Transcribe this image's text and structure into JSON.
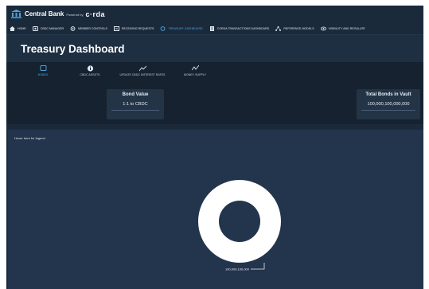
{
  "brand": {
    "name": "Central Bank",
    "powered_by": "Powered by",
    "corda": "c·rda"
  },
  "nav": {
    "items": [
      {
        "label": "HOME",
        "icon": "home-icon"
      },
      {
        "label": "CBDC MANAGER",
        "icon": "coins-icon"
      },
      {
        "label": "MEMBER CONTROLS",
        "icon": "gear-icon"
      },
      {
        "label": "RECEIVING REQUESTS",
        "icon": "inbox-icon"
      },
      {
        "label": "TREASURY DASHBOARD",
        "icon": "circle-icon",
        "active": true
      },
      {
        "label": "CORDA TRANSACTIONS DASHBOARD",
        "icon": "document-icon"
      },
      {
        "label": "REFERENCE MODELS",
        "icon": "network-icon"
      },
      {
        "label": "VISIBILITY AND REGULATE",
        "icon": "eye-icon"
      }
    ]
  },
  "page": {
    "title": "Treasury Dashboard"
  },
  "tabs": [
    {
      "label": "BONDS",
      "icon": "square-icon",
      "active": true
    },
    {
      "label": "CBDC ASSETS",
      "icon": "info-icon"
    },
    {
      "label": "UPDATE CBDC INTEREST RATES",
      "icon": "trend-icon"
    },
    {
      "label": "MONEY SUPPLY",
      "icon": "chart-line-icon"
    }
  ],
  "cards": {
    "bond_value": {
      "title": "Bond Value",
      "value": "1:1 to CBDC"
    },
    "total_bonds": {
      "title": "Total Bonds in Vault",
      "value": "100,000,100,000,000"
    }
  },
  "chart": {
    "hint": "Hover here for legend",
    "label": "100,000,100,000"
  },
  "colors": {
    "background": "#1b2a3b",
    "panel": "#23344d",
    "accent": "#4aa3df",
    "donut": "#ffffff"
  },
  "chart_data": {
    "type": "pie",
    "variant": "donut",
    "slices": [
      {
        "label": "100,000,100,000",
        "value": 100000100000
      }
    ],
    "title": "",
    "legend": "hover"
  }
}
